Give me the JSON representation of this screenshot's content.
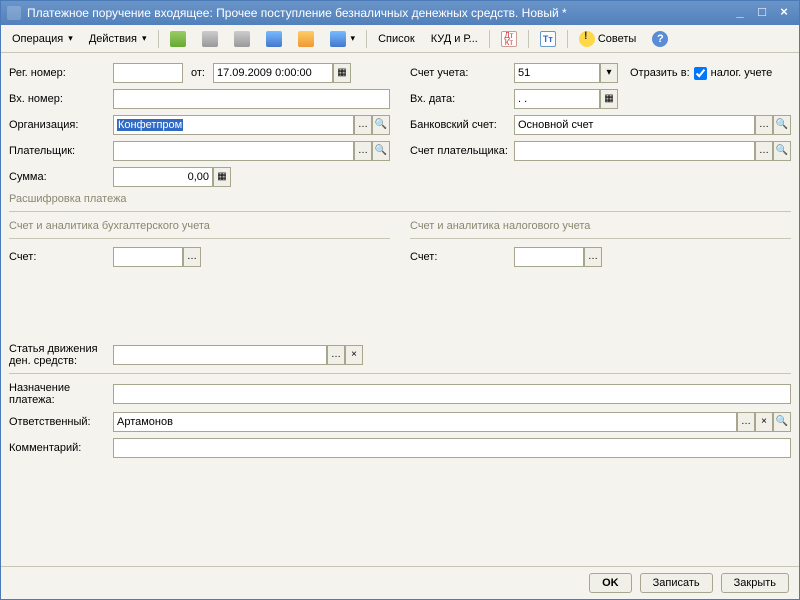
{
  "window": {
    "title": "Платежное поручение входящее: Прочее поступление безналичных денежных средств. Новый *"
  },
  "toolbar": {
    "operation": "Операция",
    "actions": "Действия",
    "list": "Список",
    "kudir": "КУД и Р...",
    "tips": "Советы"
  },
  "labels": {
    "reg_num": "Рег. номер:",
    "from": "от:",
    "in_num": "Вх. номер:",
    "org": "Организация:",
    "payer": "Плательщик:",
    "sum": "Сумма:",
    "account": "Счет учета:",
    "reflect_in": "Отразить в:",
    "tax_account_chk": "налог. учете",
    "in_date": "Вх. дата:",
    "bank_acct": "Банковский счет:",
    "payer_acct": "Счет плательщика:",
    "decode": "Расшифровка платежа",
    "acc_anal_buh": "Счет и аналитика бухгалтерского учета",
    "acc_anal_tax": "Счет и аналитика налогового учета",
    "acc": "Счет:",
    "cash_flow": "Статья движения ден. средств:",
    "purpose": "Назначение платежа:",
    "responsible": "Ответственный:",
    "comment": "Комментарий:"
  },
  "values": {
    "date": "17.09.2009 0:00:00",
    "org": "Конфетпром",
    "sum": "0,00",
    "account": "51",
    "bank_acct": "Основной счет",
    "in_date": ". .",
    "responsible": "Артамонов"
  },
  "buttons": {
    "ok": "OK",
    "save": "Записать",
    "close": "Закрыть"
  }
}
